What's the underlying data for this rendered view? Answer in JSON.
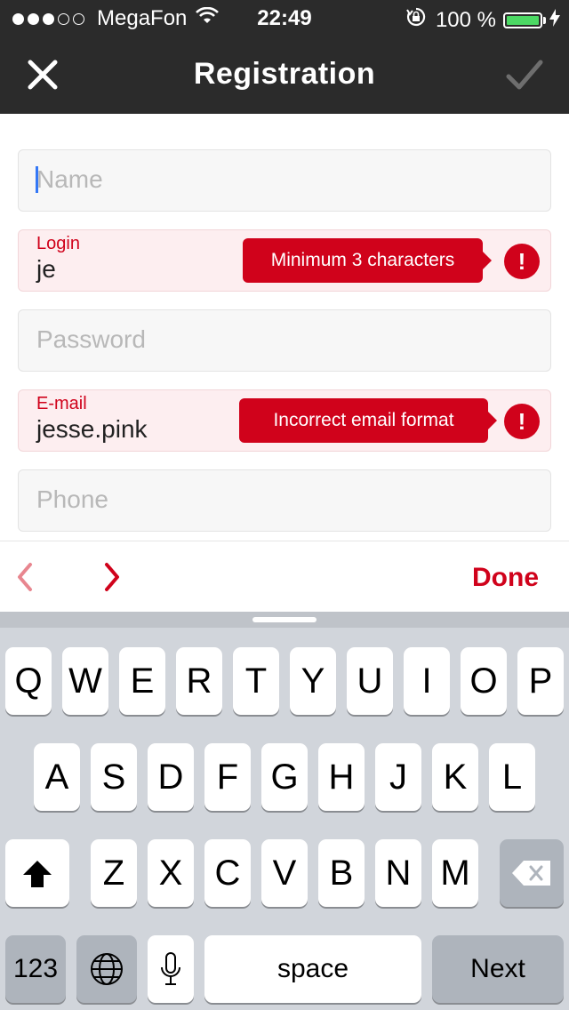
{
  "status_bar": {
    "carrier": "MegaFon",
    "time": "22:49",
    "battery_percent": "100 %",
    "battery_level": 1.0
  },
  "nav": {
    "title": "Registration",
    "close_icon": "close-icon",
    "confirm_icon": "checkmark-icon"
  },
  "form": {
    "name": {
      "placeholder": "Name"
    },
    "login": {
      "label": "Login",
      "value": "je",
      "error": "Minimum 3 characters"
    },
    "password": {
      "placeholder": "Password"
    },
    "email": {
      "label": "E-mail",
      "value": "jesse.pink",
      "error": "Incorrect email format"
    },
    "phone": {
      "placeholder": "Phone"
    }
  },
  "accessory": {
    "done_label": "Done"
  },
  "keyboard": {
    "row1": [
      "Q",
      "W",
      "E",
      "R",
      "T",
      "Y",
      "U",
      "I",
      "O",
      "P"
    ],
    "row2": [
      "A",
      "S",
      "D",
      "F",
      "G",
      "H",
      "J",
      "K",
      "L"
    ],
    "row3": [
      "Z",
      "X",
      "C",
      "V",
      "B",
      "N",
      "M"
    ],
    "numbers_label": "123",
    "space_label": "space",
    "next_label": "Next"
  },
  "colors": {
    "accent": "#d0021b",
    "bar_background": "#2b2b2b",
    "battery_green": "#4cd964"
  }
}
